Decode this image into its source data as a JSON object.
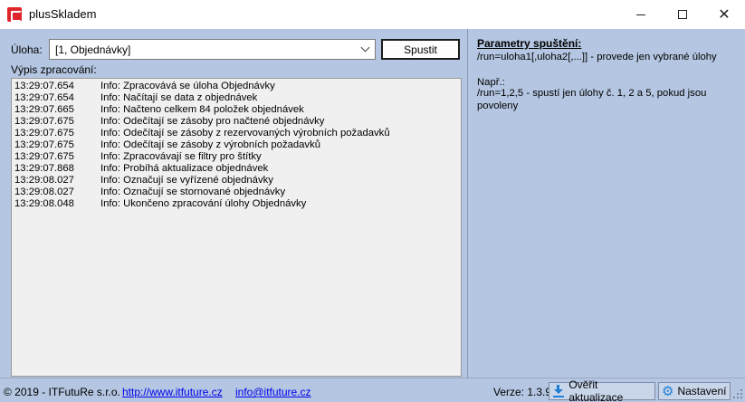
{
  "window": {
    "title": "plusSkladem",
    "minimize_glyph": "",
    "maximize_glyph": "",
    "close_glyph": "✕"
  },
  "task": {
    "label": "Úloha:",
    "selected": "[1, Objednávky]",
    "run_label": "Spustit"
  },
  "log": {
    "label": "Výpis zpracování:",
    "rows": [
      {
        "time": "13:29:07.654",
        "message": "Info: Zpracovává se úloha Objednávky"
      },
      {
        "time": "13:29:07.654",
        "message": "Info: Načítají se data z objednávek"
      },
      {
        "time": "13:29:07.665",
        "message": "Info: Načteno celkem 84 položek objednávek"
      },
      {
        "time": "13:29:07.675",
        "message": "Info: Odečítají se zásoby pro načtené objednávky"
      },
      {
        "time": "13:29:07.675",
        "message": "Info: Odečítají se zásoby z rezervovaných výrobních požadavků"
      },
      {
        "time": "13:29:07.675",
        "message": "Info: Odečítají se zásoby z výrobních požadavků"
      },
      {
        "time": "13:29:07.675",
        "message": "Info: Zpracovávají se filtry pro štítky"
      },
      {
        "time": "13:29:07.868",
        "message": "Info: Probíhá aktualizace objednávek"
      },
      {
        "time": "13:29:08.027",
        "message": "Info: Označují se vyřízené objednávky"
      },
      {
        "time": "13:29:08.027",
        "message": "Info: Označují se stornované objednávky"
      },
      {
        "time": "13:29:08.048",
        "message": "Info: Ukončeno zpracování úlohy Objednávky"
      }
    ]
  },
  "params": {
    "title": "Parametry spuštění:",
    "line1": "/run=uloha1[,uloha2[,...]] - provede jen vybrané úlohy",
    "example_label": "Např.:",
    "example_text": "/run=1,2,5 - spustí jen úlohy č. 1, 2 a 5, pokud jsou povoleny"
  },
  "status": {
    "copyright": "© 2019 - ITFutuRe s.r.o.",
    "web_link": "http://www.itfuture.cz",
    "mail_link": "info@itfuture.cz",
    "version": "Verze: 1.3.9",
    "update_label": "Ověřit aktualizace",
    "settings_label": "Nastavení",
    "gear_glyph": "⚙"
  },
  "colors": {
    "client_bg": "#b4c6e1",
    "log_bg": "#f0f0f0",
    "link": "#0000ee",
    "icon_accent": "#1f7fd6",
    "app_icon": "#e0242b"
  }
}
